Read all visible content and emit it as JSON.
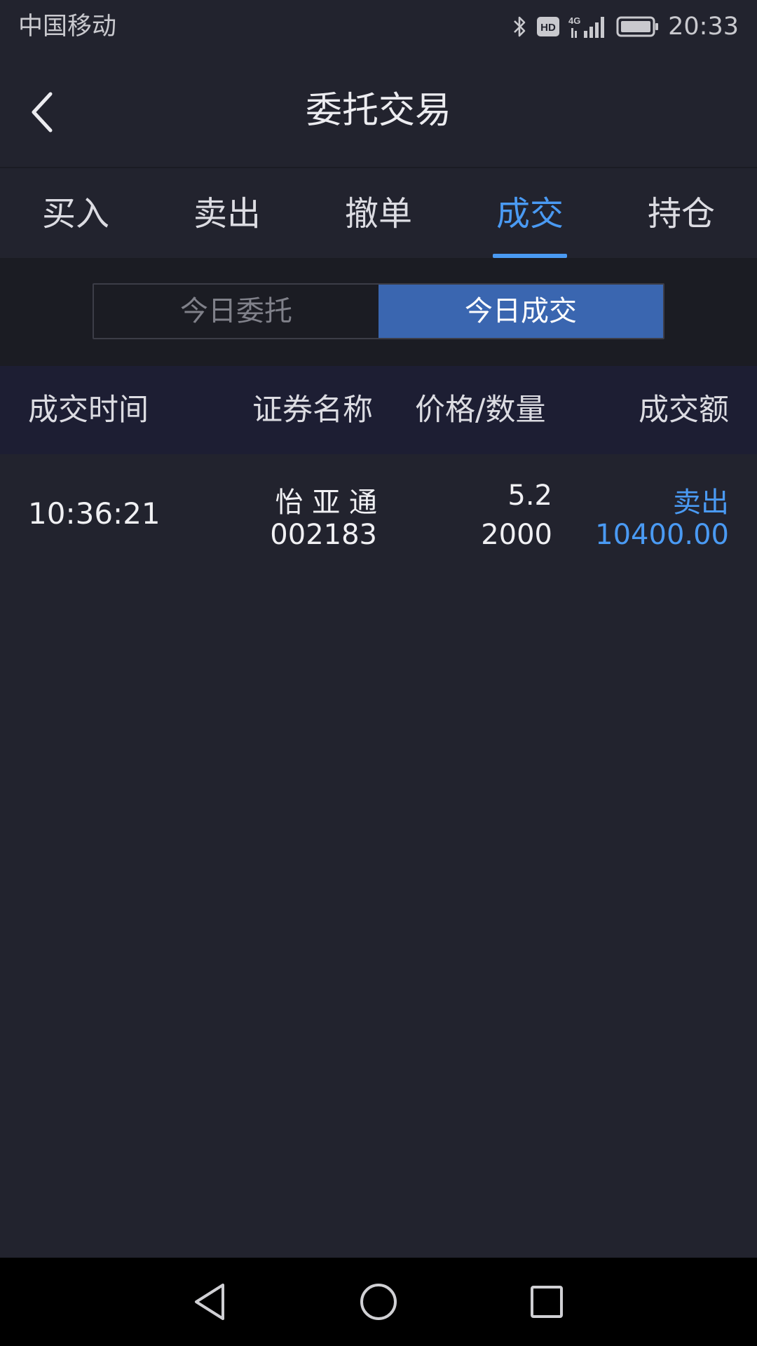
{
  "status_bar": {
    "carrier": "中国移动",
    "time": "20:33",
    "icons": [
      "bluetooth-icon",
      "hd-icon",
      "4g-signal-icon",
      "battery-icon"
    ],
    "hd_label": "HD",
    "network_label": "4G"
  },
  "header": {
    "title": "委托交易",
    "back_icon": "chevron-left-icon"
  },
  "tabs": [
    {
      "label": "买入",
      "active": false
    },
    {
      "label": "卖出",
      "active": false
    },
    {
      "label": "撤单",
      "active": false
    },
    {
      "label": "成交",
      "active": true
    },
    {
      "label": "持仓",
      "active": false
    }
  ],
  "segment": {
    "options": [
      "今日委托",
      "今日成交"
    ],
    "selected": "今日成交"
  },
  "table": {
    "columns": [
      "成交时间",
      "证券名称",
      "价格/数量",
      "成交额"
    ],
    "rows": [
      {
        "time": "10:36:21",
        "name": "怡 亚 通",
        "code": "002183",
        "price": "5.2",
        "quantity": "2000",
        "direction": "卖出",
        "amount": "10400.00"
      }
    ]
  },
  "nav_bar": {
    "icons": [
      "back-triangle-icon",
      "home-circle-icon",
      "recents-square-icon"
    ]
  },
  "colors": {
    "background": "#22232e",
    "accent": "#4a9af3",
    "segment_active": "#3a66b0",
    "table_header": "#1d1e33"
  }
}
